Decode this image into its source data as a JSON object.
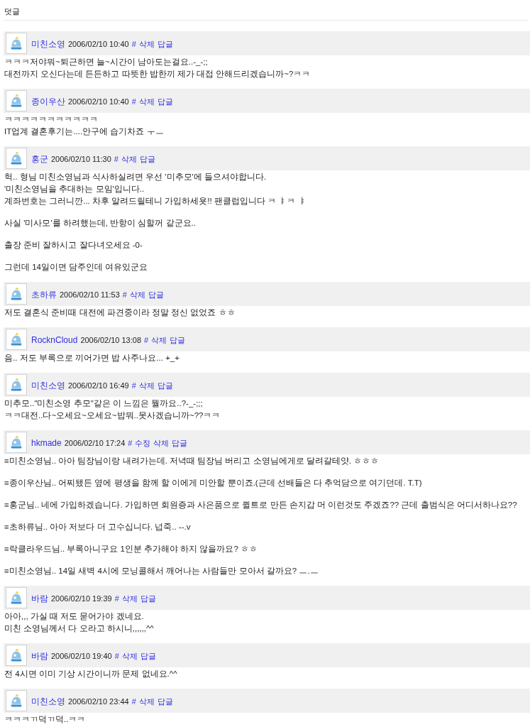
{
  "section_title": "덧글",
  "comments": [
    {
      "author": "미친소영",
      "date": "2006/02/10 10:40",
      "actions": [
        "#",
        "삭제",
        "답글"
      ],
      "paragraphs": [
        [
          "ㅋㅋㅋ저야뭐~퇴근하면 늘~시간이 남아도는걸요..-_-;;",
          "대전까지 오신다는데 든든하고 따뜻한 밥한끼 제가 대접 안해드리겠습니까~?ㅋㅋ"
        ]
      ]
    },
    {
      "author": "종이우산",
      "date": "2006/02/10 10:40",
      "actions": [
        "#",
        "삭제",
        "답글"
      ],
      "paragraphs": [
        [
          "ㅋㅋㅋㅋㅋㅋㅋㅋㅋㅋㅋ",
          "IT업계 결혼후기는....안구에 습기차죠 ㅜㅡ"
        ]
      ]
    },
    {
      "author": "홍군",
      "date": "2006/02/10 11:30",
      "actions": [
        "#",
        "삭제",
        "답글"
      ],
      "paragraphs": [
        [
          "헉.. 형님 미친소영님과 식사하실려면 우선 '미추모'에 들으셔야합니다.",
          "'미친소영님을 추대하는 모임'입니다..",
          "계좌번호는 그러니깐... 차후 알려드릴테니 가입하세욧!! 팬클럽입니다 ㅋ ㅑㅋ ㅑ"
        ],
        [
          "사실 '미사모'를 하려했는데, 반항이 심할꺼 같군요.."
        ],
        [
          "출장 준비 잘하시고 잘다녀오세요 -0-"
        ],
        [
          "그런데 14일이면 담주인데 여유있군요"
        ]
      ]
    },
    {
      "author": "초하류",
      "date": "2006/02/10 11:53",
      "actions": [
        "#",
        "삭제",
        "답글"
      ],
      "paragraphs": [
        [
          "저도 결혼식 준비때 대전에 파견중이라 정말 정신 없었죠 ㅎㅎ"
        ]
      ]
    },
    {
      "author": "RocknCloud",
      "date": "2006/02/10 13:08",
      "actions": [
        "#",
        "삭제",
        "답글"
      ],
      "paragraphs": [
        [
          "음.. 저도 부록으로 끼어가면 밥 사주나요... +_+"
        ]
      ]
    },
    {
      "author": "미친소영",
      "date": "2006/02/10 16:49",
      "actions": [
        "#",
        "삭제",
        "답글"
      ],
      "paragraphs": [
        [
          "미추모..\"미친소영 추모\"같은 이 느낌은 뭘까요..?-_-;;;",
          "ㅋㅋ대전..다~오세요~오세요~밥뭐..못사겠습니까~??ㅋㅋ"
        ]
      ]
    },
    {
      "author": "hkmade",
      "date": "2006/02/10 17:24",
      "actions": [
        "#",
        "수정",
        "삭제",
        "답글"
      ],
      "paragraphs": [
        [
          "≡미친소영님.. 아아 팀장님이랑 내려가는데. 저녁때 팀장님 버리고 소영님에게로 달려갈테얏. ㅎㅎㅎ"
        ],
        [
          "≡종이우산님.. 어찌됐든 옆에 평생을 함께 할 이에게 미안할 뿐이죠.(근데 선배들은 다 추억담으로 여기던데. T.T)"
        ],
        [
          "≡홍군님.. 네에 가입하겠습니다. 가입하면 회원증과 사은품으로 퀼트로 만든 손지갑 머 이런것도 주겠죠?? 근데 출범식은 어디서하나요??"
        ],
        [
          "≡초하류님.. 아아 저보다 더 고수십니다. 넙죽.. --.v"
        ],
        [
          "≡락클라우드님.. 부록아니구요 1인분 추가해야 하지 않을까요? ㅎㅎ"
        ],
        [
          "≡미친소영님.. 14일 새벽 4시에 모닝콜해서 깨어나는 사람들만 모아서 갈까요? ㅡ.ㅡ"
        ]
      ]
    },
    {
      "author": "바람",
      "date": "2006/02/10 19:39",
      "actions": [
        "#",
        "삭제",
        "답글"
      ],
      "paragraphs": [
        [
          "아아,,, 가실 때 저도 묻어가야 겠네요.",
          "미친 소영님께서 다 오라고 하시니,,,,,,^^"
        ]
      ]
    },
    {
      "author": "바람",
      "date": "2006/02/10 19:40",
      "actions": [
        "#",
        "삭제",
        "답글"
      ],
      "paragraphs": [
        [
          "전 4시면 이미 기상 시간이니까 문제 없네요.^^"
        ]
      ]
    },
    {
      "author": "미친소영",
      "date": "2006/02/10 23:44",
      "actions": [
        "#",
        "삭제",
        "답글"
      ],
      "paragraphs": [
        [
          "ㅋㅋㅋㄲ덕ㄲ덕..ㅋㅋ"
        ]
      ]
    }
  ]
}
